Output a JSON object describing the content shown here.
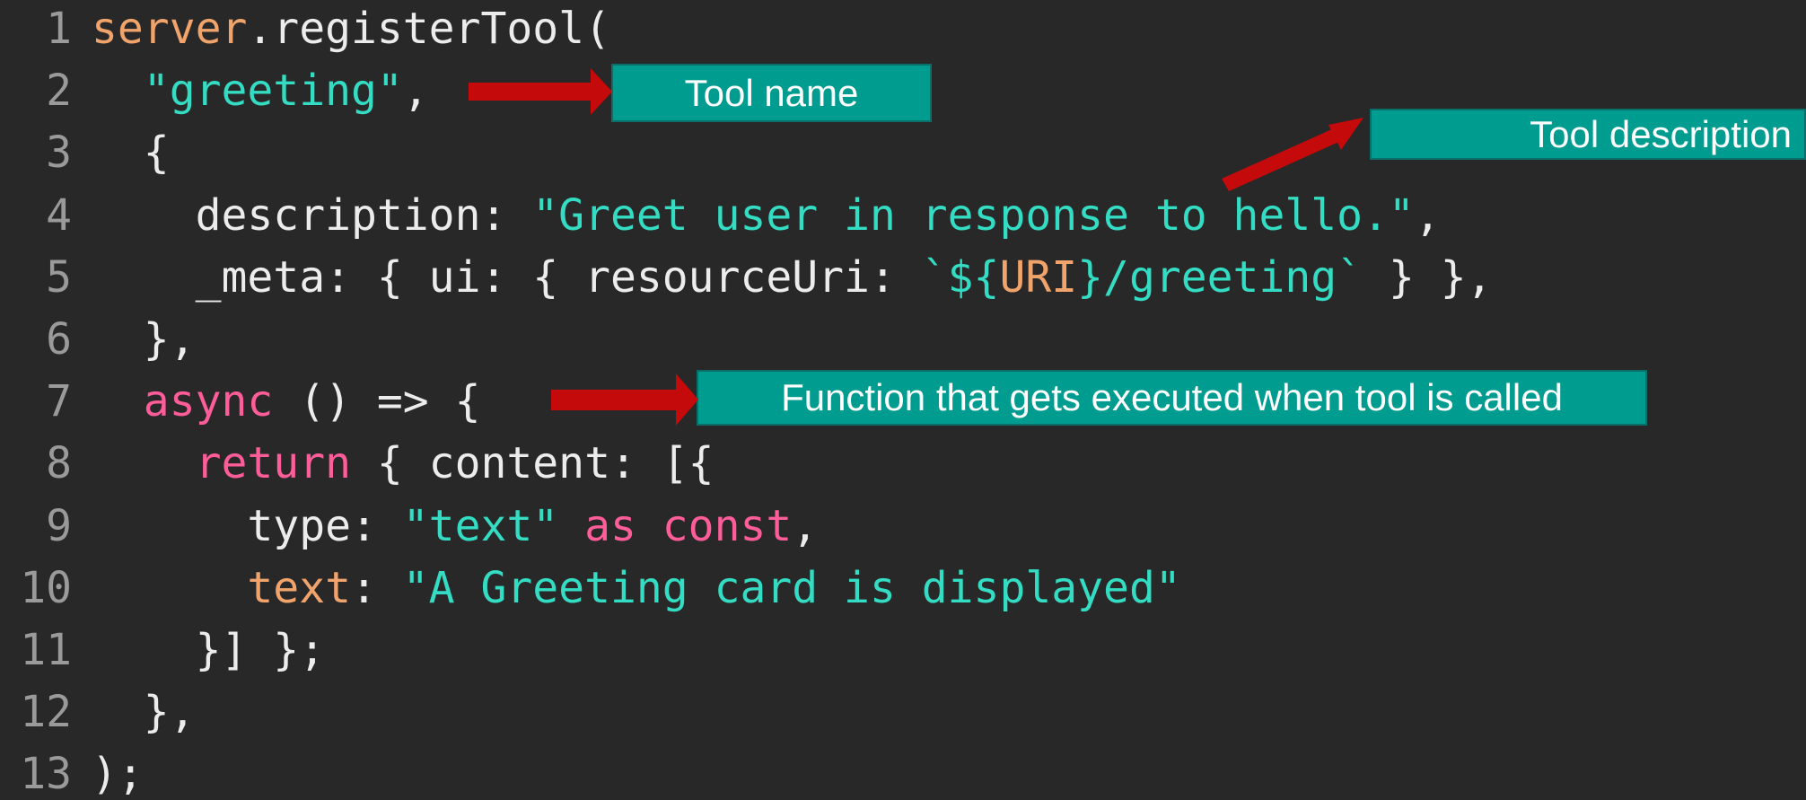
{
  "editor": {
    "lines": [
      {
        "number": "1",
        "tokens": [
          {
            "text": "server",
            "color": "orange"
          },
          {
            "text": ".registerTool(",
            "color": "white"
          }
        ]
      },
      {
        "number": "2",
        "tokens": [
          {
            "text": "  ",
            "color": "white"
          },
          {
            "text": "\"greeting\"",
            "color": "teal"
          },
          {
            "text": ",",
            "color": "white"
          }
        ]
      },
      {
        "number": "3",
        "tokens": [
          {
            "text": "  {",
            "color": "white"
          }
        ]
      },
      {
        "number": "4",
        "tokens": [
          {
            "text": "    description: ",
            "color": "white"
          },
          {
            "text": "\"Greet user in response to hello.\"",
            "color": "teal"
          },
          {
            "text": ",",
            "color": "white"
          }
        ]
      },
      {
        "number": "5",
        "tokens": [
          {
            "text": "    _meta: { ui: { resourceUri: ",
            "color": "white"
          },
          {
            "text": "`${",
            "color": "teal"
          },
          {
            "text": "URI",
            "color": "orange"
          },
          {
            "text": "}/greeting`",
            "color": "teal"
          },
          {
            "text": " } },",
            "color": "white"
          }
        ]
      },
      {
        "number": "6",
        "tokens": [
          {
            "text": "  },",
            "color": "white"
          }
        ]
      },
      {
        "number": "7",
        "tokens": [
          {
            "text": "  ",
            "color": "white"
          },
          {
            "text": "async",
            "color": "pink"
          },
          {
            "text": " () => {",
            "color": "white"
          }
        ]
      },
      {
        "number": "8",
        "tokens": [
          {
            "text": "    ",
            "color": "white"
          },
          {
            "text": "return",
            "color": "pink"
          },
          {
            "text": " { content: [{",
            "color": "white"
          }
        ]
      },
      {
        "number": "9",
        "tokens": [
          {
            "text": "      type: ",
            "color": "white"
          },
          {
            "text": "\"text\"",
            "color": "teal"
          },
          {
            "text": " ",
            "color": "white"
          },
          {
            "text": "as const",
            "color": "pink"
          },
          {
            "text": ",",
            "color": "white"
          }
        ]
      },
      {
        "number": "10",
        "tokens": [
          {
            "text": "      ",
            "color": "white"
          },
          {
            "text": "text",
            "color": "orange"
          },
          {
            "text": ": ",
            "color": "white"
          },
          {
            "text": "\"A Greeting card is displayed\"",
            "color": "teal"
          }
        ]
      },
      {
        "number": "11",
        "tokens": [
          {
            "text": "    }] };",
            "color": "white"
          }
        ]
      },
      {
        "number": "12",
        "tokens": [
          {
            "text": "  },",
            "color": "white"
          }
        ]
      },
      {
        "number": "13",
        "tokens": [
          {
            "text": ");",
            "color": "white"
          }
        ]
      }
    ]
  },
  "callouts": {
    "tool_name": "Tool name",
    "tool_description": "Tool description",
    "function": "Function that gets executed when tool is called"
  },
  "colors": {
    "background": "#282828",
    "line_number": "#9a9a9a",
    "callout_fill": "#009c8f",
    "arrow": "#c40a0a"
  }
}
